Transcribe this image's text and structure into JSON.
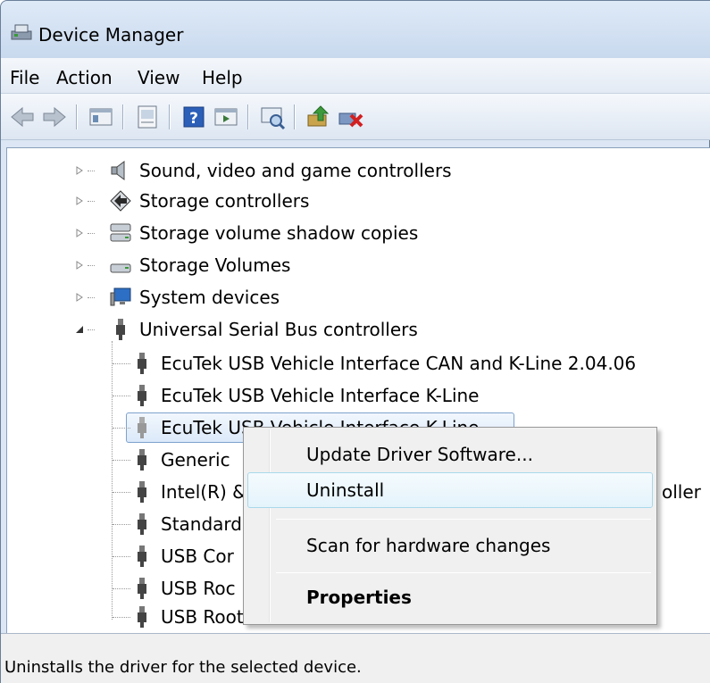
{
  "window": {
    "title": "Device Manager"
  },
  "menu": [
    "File",
    "Action",
    "View",
    "Help"
  ],
  "toolbar": {
    "buttons": [
      "back-icon",
      "forward-icon",
      "show-hide-tree-icon",
      "properties-icon",
      "help-icon",
      "run-icon",
      "scan-hardware-icon",
      "update-driver-icon",
      "uninstall-icon"
    ]
  },
  "tree": {
    "categories": [
      {
        "label": "Sound, video and game controllers",
        "icon": "speaker-icon"
      },
      {
        "label": "Storage controllers",
        "icon": "storage-controller-icon"
      },
      {
        "label": "Storage volume shadow copies",
        "icon": "drive-stack-icon"
      },
      {
        "label": "Storage Volumes",
        "icon": "drive-icon"
      },
      {
        "label": "System devices",
        "icon": "computer-icon"
      },
      {
        "label": "Universal Serial Bus controllers",
        "icon": "usb-plug-icon"
      }
    ],
    "usb_children": [
      "EcuTek USB Vehicle Interface CAN and K-Line 2.04.06",
      "EcuTek USB Vehicle Interface K-Line",
      "EcuTek USB Vehicle Interface K-Line",
      "Generic",
      "Intel(R) &",
      "Standard",
      "USB Cor",
      "USB Roc",
      "USB Root Hub"
    ],
    "intel_suffix": "oller"
  },
  "context_menu": {
    "items": [
      "Update Driver Software...",
      "Uninstall",
      "Scan for hardware changes",
      "Properties"
    ]
  },
  "status": {
    "text": "Uninstalls the driver for the selected device."
  }
}
